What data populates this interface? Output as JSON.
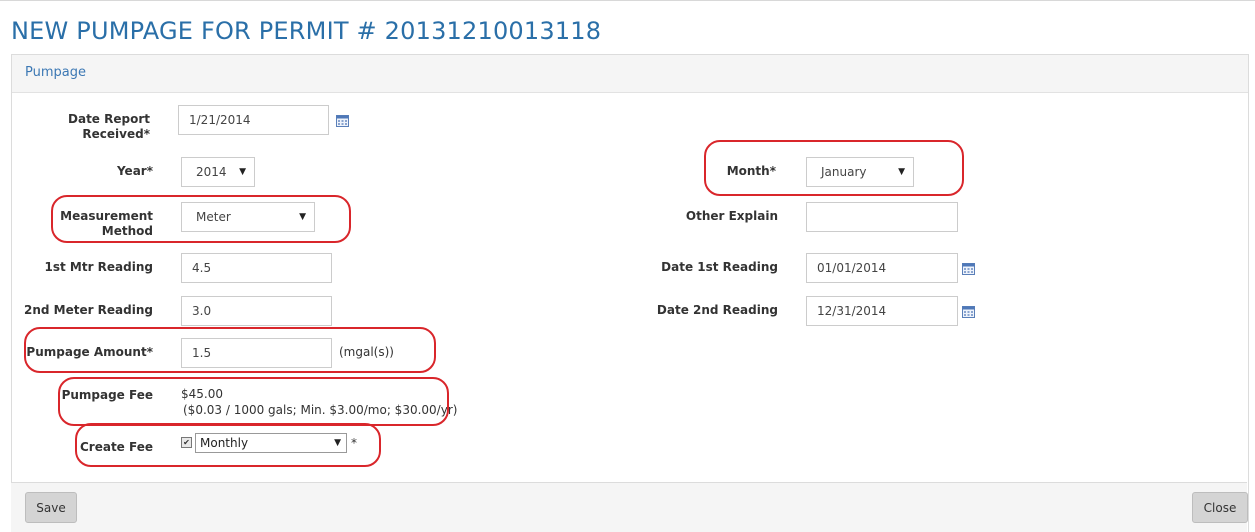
{
  "page": {
    "title": "NEW PUMPAGE FOR PERMIT # 20131210013118"
  },
  "panel": {
    "title": "Pumpage"
  },
  "form": {
    "date_received": {
      "label": "Date Report Received*",
      "value": "1/21/2014"
    },
    "year": {
      "label": "Year*",
      "value": "2014"
    },
    "month": {
      "label": "Month*",
      "value": "January"
    },
    "measurement_method": {
      "label": "Measurement Method",
      "value": "Meter"
    },
    "other_explain": {
      "label": "Other Explain",
      "value": ""
    },
    "first_reading": {
      "label": "1st Mtr Reading",
      "value": "4.5"
    },
    "date_first_reading": {
      "label": "Date 1st Reading",
      "value": "01/01/2014"
    },
    "second_reading": {
      "label": "2nd Meter Reading",
      "value": "3.0"
    },
    "date_second_reading": {
      "label": "Date 2nd Reading",
      "value": "12/31/2014"
    },
    "pumpage_amount": {
      "label": "Pumpage Amount*",
      "value": "1.5",
      "unit": "(mgal(s))"
    },
    "pumpage_fee": {
      "label": "Pumpage Fee",
      "value": "$45.00",
      "note": "($0.03 / 1000 gals; Min. $3.00/mo; $30.00/yr)"
    },
    "create_fee": {
      "label": "Create Fee",
      "checked": true,
      "value": "Monthly",
      "required_mark": "*"
    }
  },
  "buttons": {
    "save": "Save",
    "close": "Close"
  },
  "icons": {
    "calendar": "calendar-icon",
    "dropdown": "chevron-down-icon",
    "check": "checkmark-icon"
  },
  "colors": {
    "title": "#2a6fa8",
    "highlight": "#d9262b",
    "button": "#d4d4d4"
  }
}
